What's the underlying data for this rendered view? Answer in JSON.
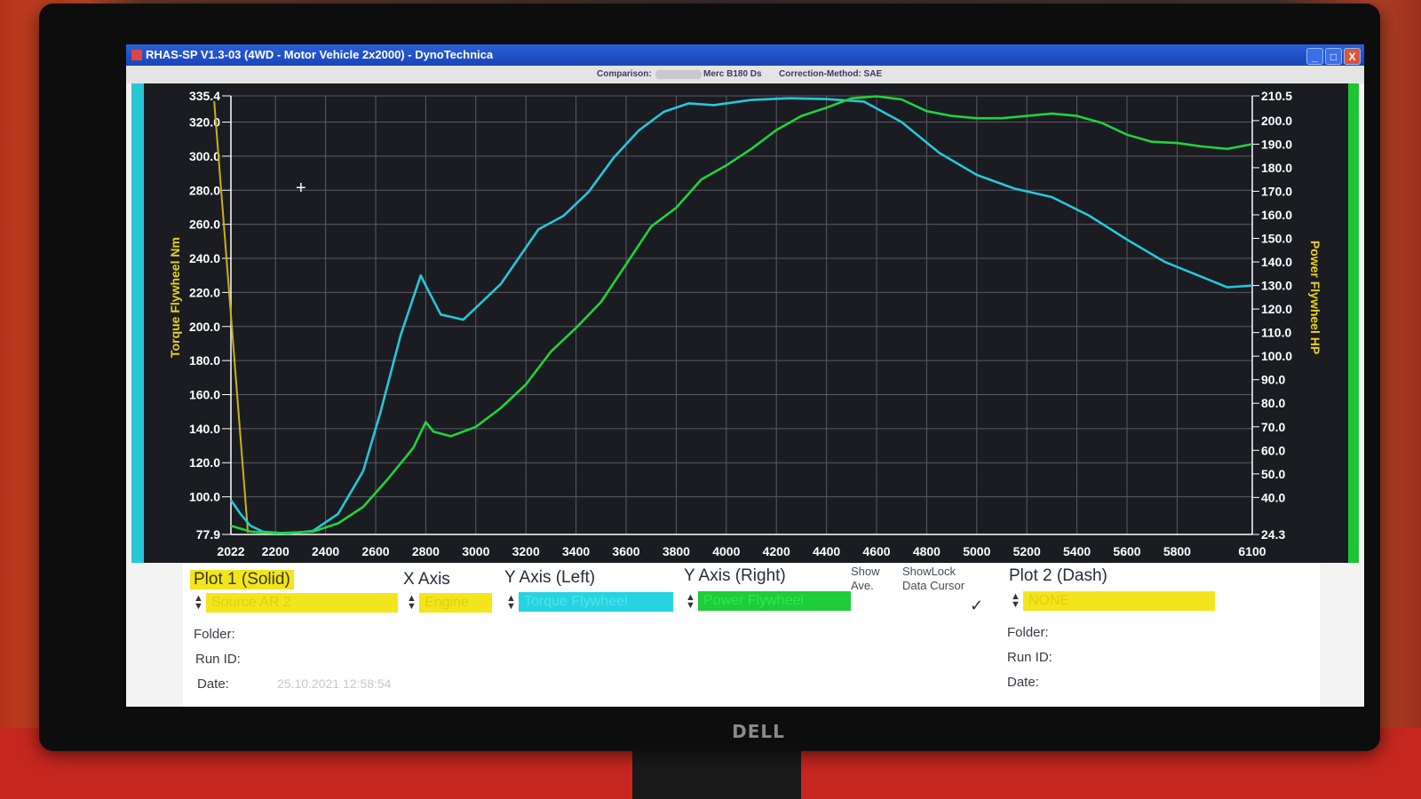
{
  "window": {
    "title": "RHAS-SP V1.3-03  (4WD - Motor Vehicle 2x2000) - DynoTechnica",
    "buttons": {
      "minimize": "_",
      "maximize": "□",
      "close": "X"
    }
  },
  "infobar": {
    "comparison_label": "Comparison:",
    "vehicle": "Merc B180 Ds",
    "correction": "Correction-Method: SAE"
  },
  "chart_data": {
    "type": "line",
    "x_ticks": [
      "2022",
      "2200",
      "2400",
      "2600",
      "2800",
      "3000",
      "3200",
      "3400",
      "3600",
      "3800",
      "4000",
      "4200",
      "4400",
      "4600",
      "4800",
      "5000",
      "5200",
      "5400",
      "5600",
      "5800",
      "6100"
    ],
    "xlim": [
      2022,
      6100
    ],
    "y_left": {
      "label": "Torque Flywheel Nm",
      "ticks": [
        "335.4",
        "320.0",
        "300.0",
        "280.0",
        "260.0",
        "240.0",
        "220.0",
        "200.0",
        "180.0",
        "160.0",
        "140.0",
        "120.0",
        "100.0",
        "77.9"
      ],
      "lim": [
        77.9,
        335.4
      ]
    },
    "y_right": {
      "label": "Power Flywheel HP",
      "ticks": [
        "210.5",
        "200.0",
        "190.0",
        "180.0",
        "170.0",
        "160.0",
        "150.0",
        "140.0",
        "130.0",
        "120.0",
        "110.0",
        "100.0",
        "90.0",
        "80.0",
        "70.0",
        "60.0",
        "50.0",
        "40.0",
        "24.3"
      ],
      "lim": [
        24.3,
        210.5
      ]
    },
    "grid": true,
    "cursor_rpm": 2090,
    "series": [
      {
        "name": "Torque Flywheel",
        "axis": "left",
        "color": "#27c7d8",
        "points": [
          [
            2022,
            98
          ],
          [
            2060,
            90
          ],
          [
            2100,
            83
          ],
          [
            2150,
            79.5
          ],
          [
            2250,
            78.4
          ],
          [
            2350,
            80
          ],
          [
            2450,
            90
          ],
          [
            2550,
            115
          ],
          [
            2620,
            150
          ],
          [
            2700,
            195
          ],
          [
            2780,
            230
          ],
          [
            2800,
            224
          ],
          [
            2860,
            207
          ],
          [
            2950,
            204
          ],
          [
            3100,
            225
          ],
          [
            3250,
            257
          ],
          [
            3350,
            265
          ],
          [
            3450,
            279
          ],
          [
            3550,
            299
          ],
          [
            3650,
            315
          ],
          [
            3750,
            326
          ],
          [
            3850,
            331
          ],
          [
            3950,
            330
          ],
          [
            4100,
            333
          ],
          [
            4250,
            334
          ],
          [
            4400,
            333.5
          ],
          [
            4550,
            332
          ],
          [
            4700,
            320
          ],
          [
            4850,
            302
          ],
          [
            5000,
            289
          ],
          [
            5150,
            281
          ],
          [
            5300,
            276
          ],
          [
            5450,
            265
          ],
          [
            5600,
            251
          ],
          [
            5750,
            238
          ],
          [
            5900,
            229
          ],
          [
            6000,
            223
          ],
          [
            6100,
            224
          ]
        ]
      },
      {
        "name": "Power Flywheel",
        "axis": "right",
        "color": "#1fd43e",
        "points": [
          [
            2022,
            28
          ],
          [
            2100,
            25.5
          ],
          [
            2200,
            24.8
          ],
          [
            2350,
            25.5
          ],
          [
            2450,
            29
          ],
          [
            2550,
            36
          ],
          [
            2650,
            48
          ],
          [
            2750,
            61
          ],
          [
            2800,
            72
          ],
          [
            2830,
            68
          ],
          [
            2900,
            66
          ],
          [
            3000,
            70
          ],
          [
            3100,
            78
          ],
          [
            3200,
            88
          ],
          [
            3300,
            102
          ],
          [
            3400,
            112
          ],
          [
            3500,
            123
          ],
          [
            3600,
            139
          ],
          [
            3700,
            155
          ],
          [
            3800,
            163
          ],
          [
            3900,
            175
          ],
          [
            4000,
            181
          ],
          [
            4100,
            188
          ],
          [
            4200,
            196
          ],
          [
            4300,
            202
          ],
          [
            4400,
            205.5
          ],
          [
            4500,
            209.5
          ],
          [
            4600,
            210.3
          ],
          [
            4700,
            209
          ],
          [
            4800,
            204
          ],
          [
            4900,
            202
          ],
          [
            5000,
            201
          ],
          [
            5100,
            201
          ],
          [
            5200,
            202
          ],
          [
            5300,
            203
          ],
          [
            5400,
            202
          ],
          [
            5500,
            199
          ],
          [
            5600,
            194
          ],
          [
            5700,
            191
          ],
          [
            5800,
            190.5
          ],
          [
            5900,
            189
          ],
          [
            6000,
            188
          ],
          [
            6100,
            190
          ]
        ]
      }
    ]
  },
  "panel": {
    "plot1_title": "Plot 1 (Solid)",
    "x_axis_title": "X Axis",
    "y_left_title": "Y Axis (Left)",
    "y_right_title": "Y Axis (Right)",
    "show_ave_line1": "Show",
    "show_ave_line2": "Ave.",
    "showlock_line1": "ShowLock",
    "showlock_line2": "Data Cursor",
    "checkmark": "✓",
    "plot2_title": "Plot 2 (Dash)",
    "plot1_source": "Source AR 2",
    "x_axis_value": "Engine",
    "y_left_value": "Torque Flywheel",
    "y_right_value": "Power Flywheel",
    "plot2_source": "NONE",
    "folder_label": "Folder:",
    "runid_label": "Run ID:",
    "date_label": "Date:",
    "plot1_date": "25.10.2021  12:58:54",
    "plot2_folder_label": "Folder:",
    "plot2_runid_label": "Run ID:",
    "plot2_date_label": "Date:"
  },
  "colors": {
    "plot_bg": "#1b1c22",
    "grid": "#5a5b63",
    "torque": "#27c7d8",
    "power": "#1fd43e",
    "cursor": "#c9b21a",
    "axis_label": "#e8d21e"
  },
  "monitor": {
    "brand": "DELL"
  }
}
